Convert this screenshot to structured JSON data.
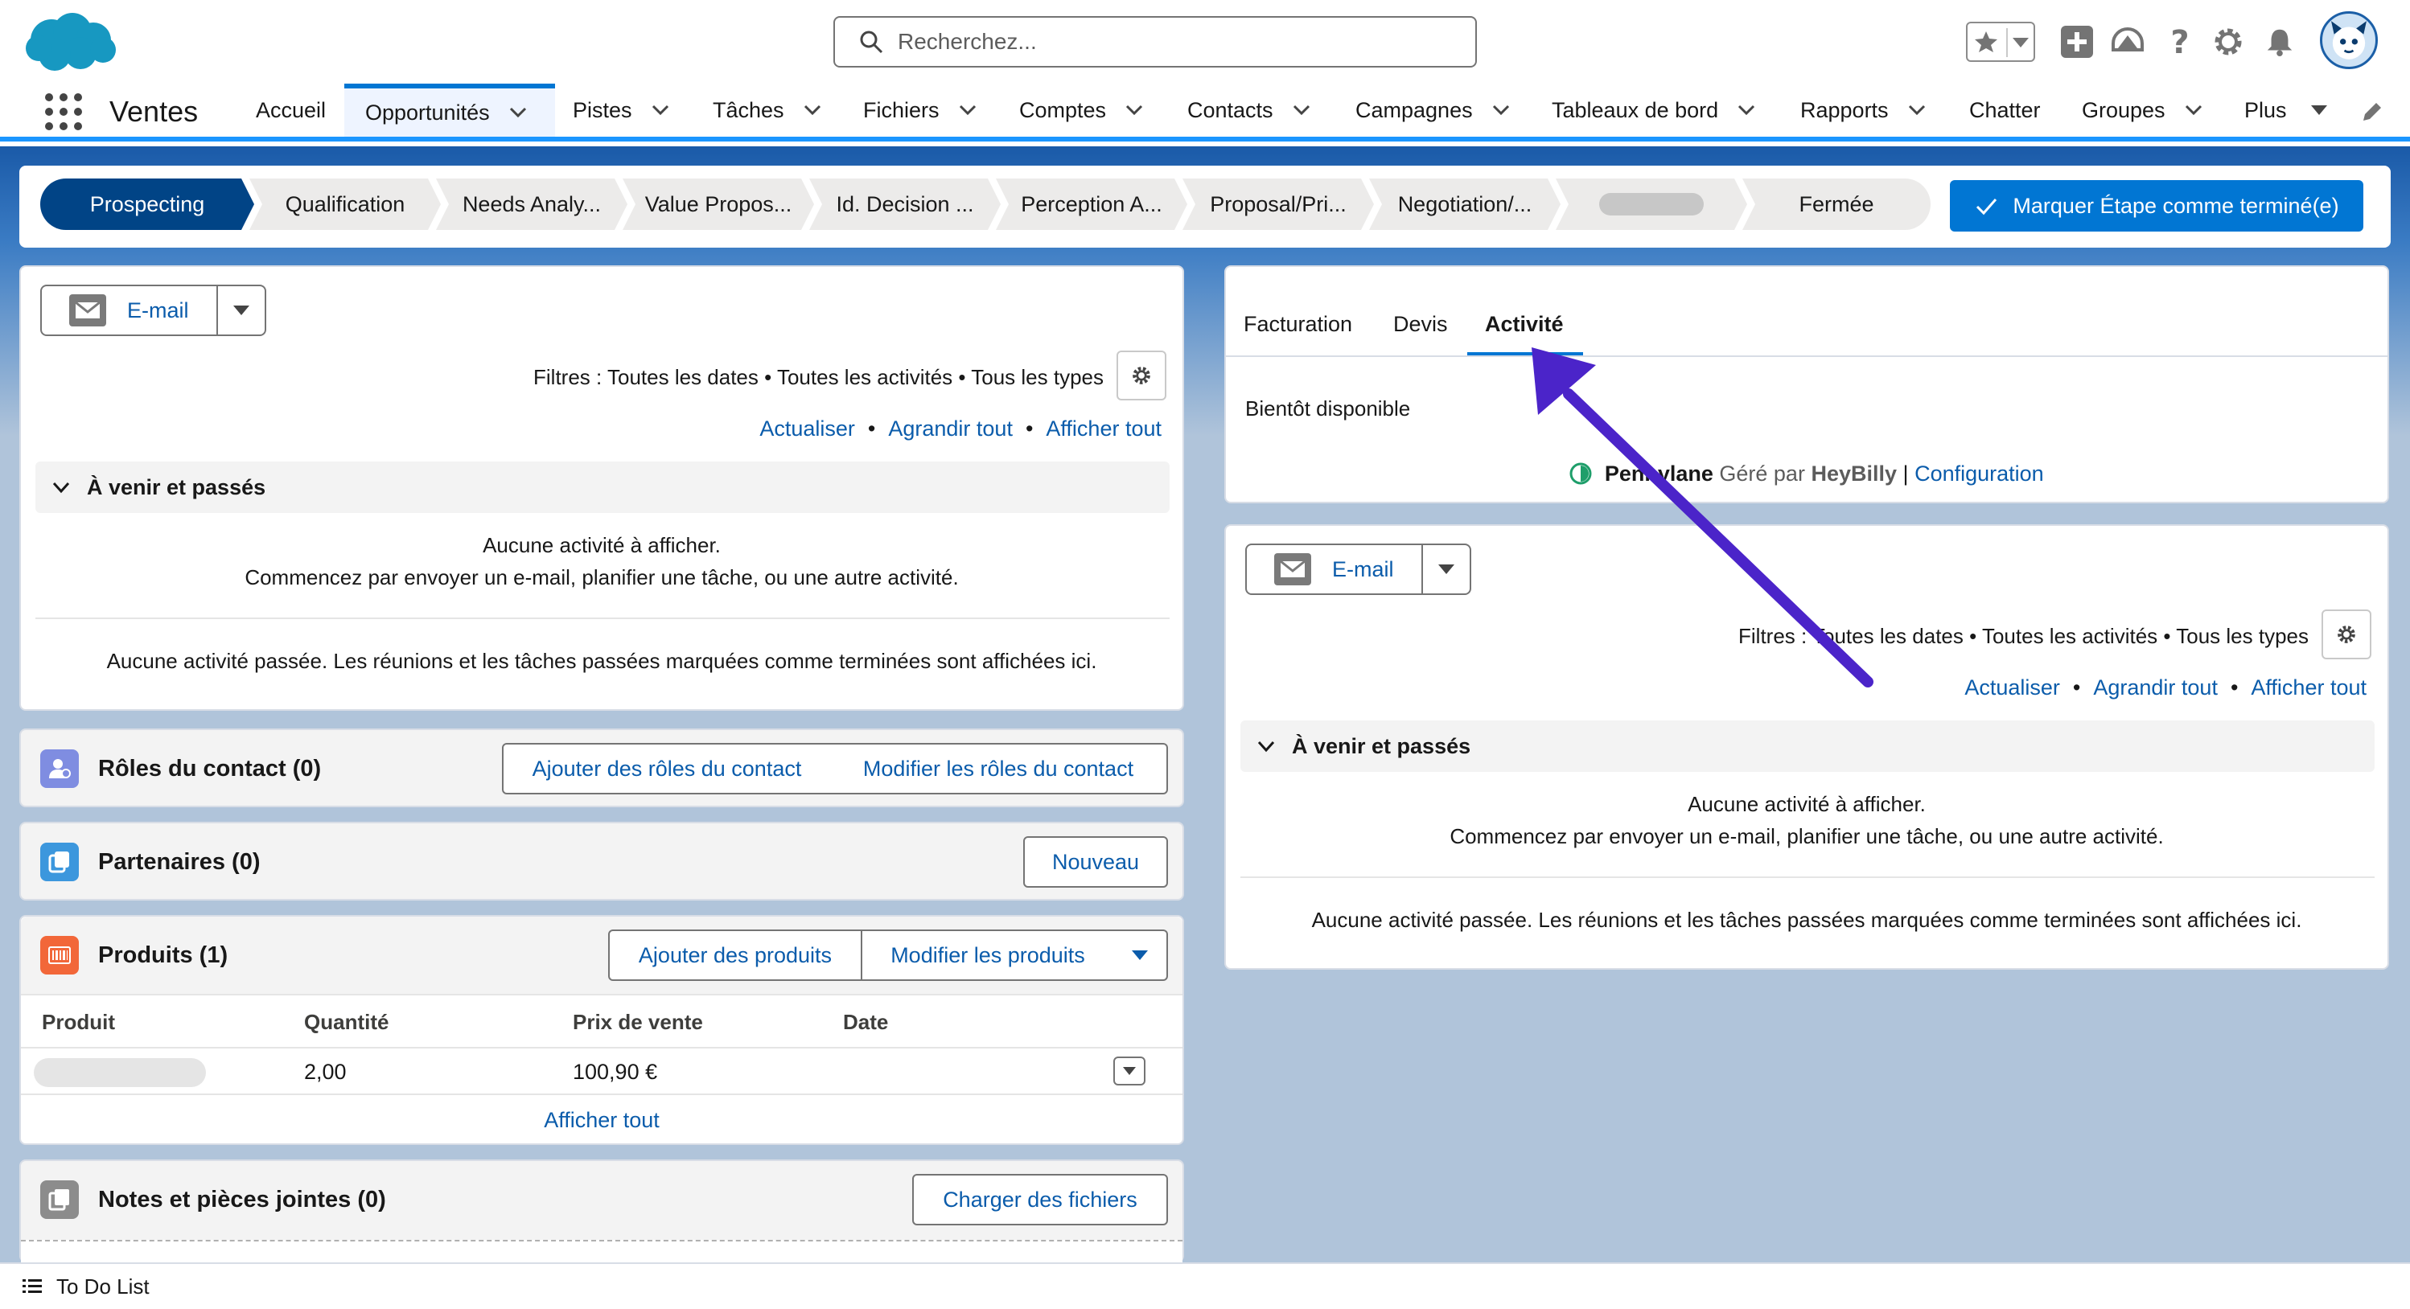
{
  "header": {
    "search_placeholder": "Recherchez...",
    "icons": [
      "salesforce-cloud-logo",
      "search-icon",
      "favorites-star-icon",
      "add-icon",
      "trailhead-icon",
      "help-icon",
      "setup-gear-icon",
      "notifications-bell-icon",
      "user-avatar"
    ]
  },
  "nav": {
    "app_name": "Ventes",
    "items": [
      {
        "label": "Accueil"
      },
      {
        "label": "Opportunités"
      },
      {
        "label": "Pistes"
      },
      {
        "label": "Tâches"
      },
      {
        "label": "Fichiers"
      },
      {
        "label": "Comptes"
      },
      {
        "label": "Contacts"
      },
      {
        "label": "Campagnes"
      },
      {
        "label": "Tableaux de bord"
      },
      {
        "label": "Rapports"
      },
      {
        "label": "Chatter"
      },
      {
        "label": "Groupes"
      },
      {
        "label": "Plus"
      }
    ],
    "active": "Opportunités"
  },
  "path": {
    "stages": [
      "Prospecting",
      "Qualification",
      "Needs Analy...",
      "Value Propos...",
      "Id. Decision ...",
      "Perception A...",
      "Proposal/Pri...",
      "Negotiation/...",
      "",
      "Fermée"
    ],
    "current": "Prospecting",
    "mark_button": "Marquer Étape comme terminé(e)"
  },
  "activity_left": {
    "email_button": "E-mail",
    "filters": "Filtres : Toutes les dates • Toutes les activités • Tous les types",
    "refresh": "Actualiser",
    "expand_all": "Agrandir tout",
    "view_all": "Afficher tout",
    "section_title": "À venir et passés",
    "empty_line1": "Aucune activité à afficher.",
    "empty_line2": "Commencez par envoyer un e-mail, planifier une tâche, ou une autre activité.",
    "past_empty": "Aucune activité passée. Les réunions et les tâches passées marquées comme terminées sont affichées ici."
  },
  "related": {
    "contact_roles": {
      "title": "Rôles du contact (0)",
      "add": "Ajouter des rôles du contact",
      "edit": "Modifier les rôles du contact"
    },
    "partners": {
      "title": "Partenaires (0)",
      "new": "Nouveau"
    },
    "products": {
      "title": "Produits (1)",
      "add": "Ajouter des produits",
      "edit": "Modifier les produits",
      "columns": [
        "Produit",
        "Quantité",
        "Prix de vente",
        "Date"
      ],
      "row": {
        "quantity": "2,00",
        "price": "100,90 €",
        "date": ""
      },
      "view_all": "Afficher tout"
    },
    "notes": {
      "title": "Notes et pièces jointes (0)",
      "upload": "Charger des fichiers"
    }
  },
  "right_tabs": {
    "tabs": [
      "Facturation",
      "Devis",
      "Activité"
    ],
    "active": "Activité",
    "coming_soon": "Bientôt disponible",
    "brand": "Pennylane",
    "managed_by": "Géré par",
    "provider": "HeyBilly",
    "separator": "|",
    "config_link": "Configuration"
  },
  "activity_right": {
    "email_button": "E-mail",
    "filters": "Filtres : Toutes les dates • Toutes les activités • Tous les types",
    "refresh": "Actualiser",
    "expand_all": "Agrandir tout",
    "view_all": "Afficher tout",
    "section_title": "À venir et passés",
    "empty_line1": "Aucune activité à afficher.",
    "empty_line2": "Commencez par envoyer un e-mail, planifier une tâche, ou une autre activité.",
    "past_empty": "Aucune activité passée. Les réunions et les tâches passées marquées comme terminées sont affichées ici."
  },
  "footer": {
    "todo": "To Do List"
  },
  "colors": {
    "brand_blue": "#0176d3",
    "link": "#0b5cab",
    "path_current": "#014486",
    "annotation_arrow": "#4b24c9"
  }
}
